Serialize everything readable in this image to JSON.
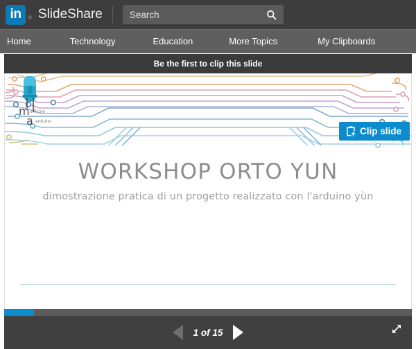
{
  "header": {
    "logo_alt": "LinkedIn",
    "logo_letters": "in",
    "registered_mark": "®",
    "brand": "SlideShare",
    "brand_color": "#0c7ab5",
    "search": {
      "placeholder": "Search",
      "value": "",
      "icon": "search-icon"
    }
  },
  "nav": {
    "items": [
      {
        "label": "Home"
      },
      {
        "label": "Technology"
      },
      {
        "label": "Education"
      },
      {
        "label": "More Topics"
      },
      {
        "label": "My Clipboards"
      }
    ]
  },
  "player": {
    "clip_banner_text": "Be the first to clip this slide",
    "clip_button": {
      "label": "Clip slide",
      "icon": "clipboard-plus-icon",
      "color": "#0d8ccd"
    },
    "slide": {
      "title": "WORKSHOP ORTO YUN",
      "subtitle": "dimostrazione pratica di un progetto realizzato con l'arduino yùn",
      "logo_name": "officine-arduino-led-logo",
      "logo_letters": "ma",
      "logo_sub_left": "officine",
      "logo_sub_right": "arduino",
      "graphic_name": "circuit-traces-decoration",
      "title_color": "#8d8d8d",
      "subtitle_color": "#a0a0a0"
    },
    "controls": {
      "prev_label": "Previous slide",
      "next_label": "Next slide",
      "page_label": "1 of 15",
      "current_page": 1,
      "total_pages": 15,
      "progress_percent": 7.3,
      "progress_color": "#0d8ccd",
      "fullscreen_label": "Fullscreen"
    }
  }
}
